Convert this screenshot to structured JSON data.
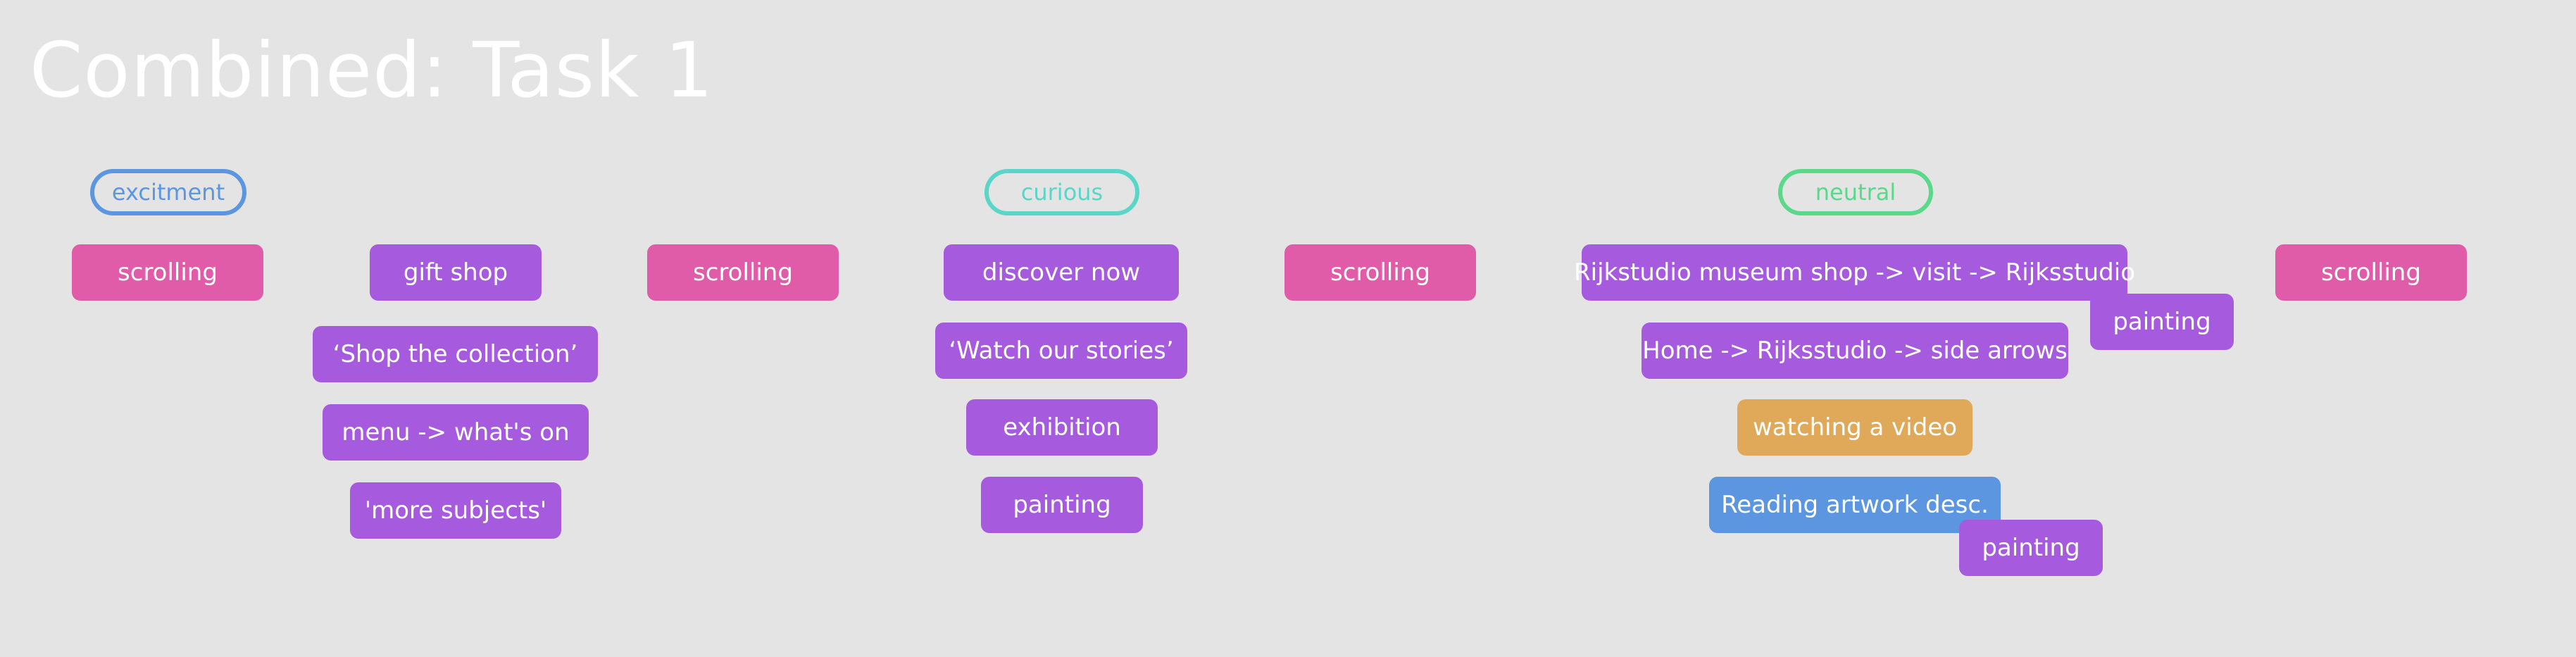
{
  "title": "Combined: Task 1",
  "colors": {
    "background": "#e4e4e4",
    "scrolling": "#e05ca8",
    "action": "#a65ade",
    "video": "#e0a95a",
    "reading": "#5c95e0",
    "excitement": "#5c95e0",
    "curious": "#5ad6c8",
    "neutral": "#5ad98a"
  },
  "emotions": {
    "excitement": "excitment",
    "curious": "curious",
    "neutral": "neutral"
  },
  "tags": {
    "scrolling_1": "scrolling",
    "gift_shop": "gift shop",
    "shop_collection": "‘Shop the collection’",
    "menu_whats_on": "menu -> what's on",
    "more_subjects": "'more subjects'",
    "scrolling_2": "scrolling",
    "discover_now": "discover now",
    "watch_stories": "‘Watch our stories’",
    "exhibition": "exhibition",
    "painting_1": "painting",
    "scrolling_3": "scrolling",
    "rijkstudio_path": "Rijkstudio museum shop -> visit -> Rijksstudio",
    "painting_2": "painting",
    "home_path": "Home -> Rijksstudio -> side arrows",
    "watching_video": "watching a video",
    "reading_artwork": "Reading artwork desc.",
    "painting_3": "painting",
    "scrolling_4": "scrolling"
  }
}
